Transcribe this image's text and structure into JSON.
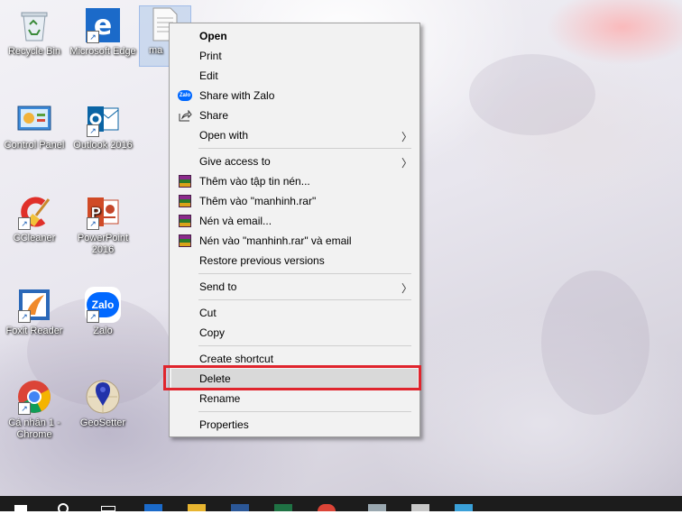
{
  "desktop": {
    "icons": [
      {
        "label": "Recycle Bin",
        "icon": "recycle-bin-icon"
      },
      {
        "label": "Microsoft Edge",
        "icon": "edge-icon"
      },
      {
        "label": "ma",
        "icon": "text-file-icon"
      },
      {
        "label": "Control Panel",
        "icon": "control-panel-icon"
      },
      {
        "label": "Outlook 2016",
        "icon": "outlook-icon"
      },
      {
        "label": "CCleaner",
        "icon": "ccleaner-icon"
      },
      {
        "label": "PowerPoint 2016",
        "icon": "powerpoint-icon"
      },
      {
        "label": "Foxit Reader",
        "icon": "foxit-icon"
      },
      {
        "label": "Zalo",
        "icon": "zalo-icon"
      },
      {
        "label": "Cá nhân 1 - Chrome",
        "icon": "chrome-icon"
      },
      {
        "label": "GeoSetter",
        "icon": "geosetter-icon"
      }
    ]
  },
  "context_menu": {
    "items": {
      "open": "Open",
      "print": "Print",
      "edit": "Edit",
      "share_zalo": "Share with Zalo",
      "share": "Share",
      "open_with": "Open with",
      "give_access": "Give access to",
      "rar_add_archive": "Thêm vào tập tin nén...",
      "rar_add_named": "Thêm vào \"manhinh.rar\"",
      "rar_compress_email": "Nén và email...",
      "rar_compress_named_email": "Nén vào \"manhinh.rar\" và email",
      "restore": "Restore previous versions",
      "send_to": "Send to",
      "cut": "Cut",
      "copy": "Copy",
      "create_shortcut": "Create shortcut",
      "delete": "Delete",
      "rename": "Rename",
      "properties": "Properties"
    },
    "zalo_badge": "Zalo",
    "highlight_color": "#e0252d"
  }
}
